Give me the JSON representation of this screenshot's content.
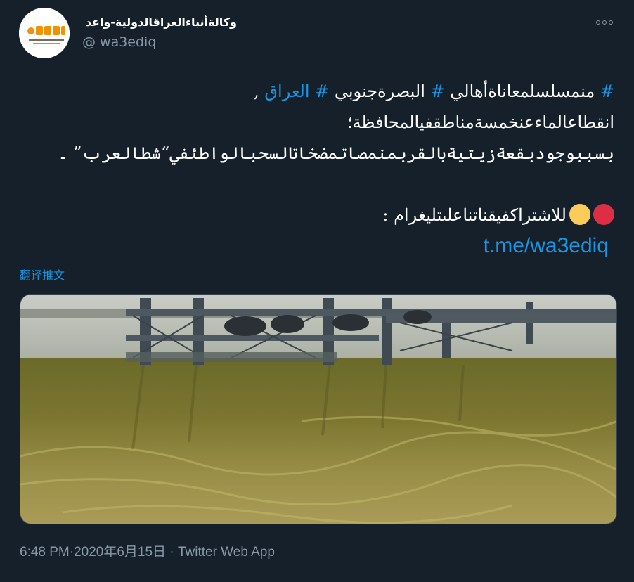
{
  "author": {
    "display_name": "وكالةأنباءالعراقالدولية-واعد",
    "handle": "@ wa3ediq",
    "avatar_icon": "wa3ed-logo-icon",
    "avatar_logo_text": "واعد",
    "avatar_logo_sub": "وكالة أنباء العراق الدولية"
  },
  "tweet": {
    "line1": [
      {
        "text": "# ",
        "type": "hash"
      },
      {
        "text": "منمسلسلمعاناةأهالي ",
        "type": "plain"
      },
      {
        "text": "# ",
        "type": "hash"
      },
      {
        "text": "البصرةجنوبي ",
        "type": "plain"
      },
      {
        "text": "# العراق",
        "type": "hash"
      },
      {
        "text": "  ,",
        "type": "plain"
      }
    ],
    "line2": "انقطاعالماءعنخمسةمناطقفيالمحافظة؛",
    "line3": "بسببوجودبقعةزيتيةبالقربمنمصاتمضخاتالسحبالواطئفي“شطالعرب”  ۔",
    "line4_text": "للاشتراكفيقناتناعلىتليغرام  :",
    "line4_emojis": [
      "red-circle-icon",
      "yellow-circle-icon"
    ],
    "link": "t.me/wa3ediq"
  },
  "translate_label": "翻译推文",
  "media": {
    "alt": "photo-oil-slick-shatt-al-arab",
    "icon": "photo-image"
  },
  "meta": {
    "time": "6:48 PM",
    "separator": "·",
    "date": "2020年6月15日",
    "dot": " · ",
    "source": "Twitter Web App"
  },
  "colors": {
    "background": "#15202b",
    "link": "#1b95e0",
    "secondary": "#8899a6",
    "red_emoji": "#dd2e44",
    "yellow_emoji": "#fdcb58"
  }
}
